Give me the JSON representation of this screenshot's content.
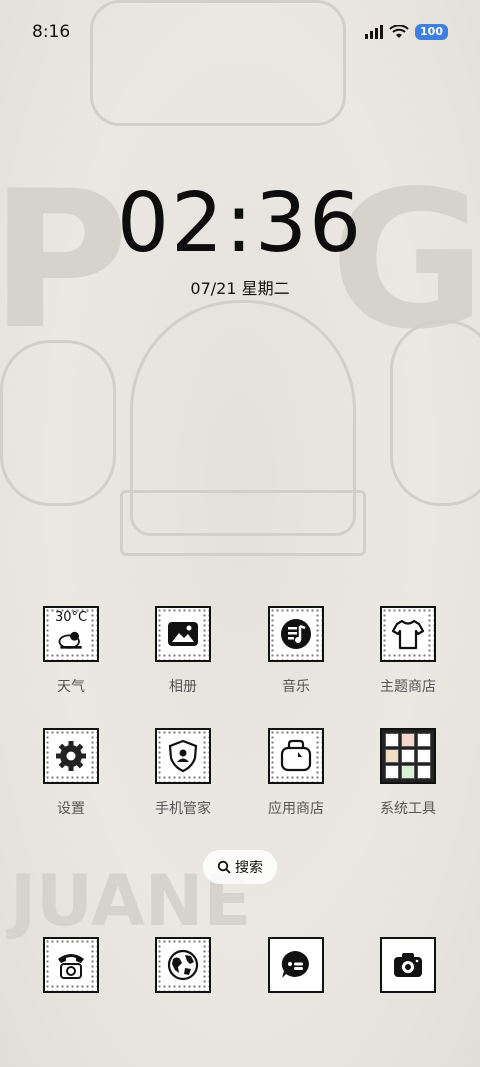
{
  "status_bar": {
    "time": "8:16",
    "battery": "100"
  },
  "lock": {
    "clock": "02:36",
    "date": "07/21 星期二"
  },
  "weather_widget": {
    "temp": "30°C"
  },
  "apps_row1": [
    {
      "label": "天气",
      "icon": "weather-icon"
    },
    {
      "label": "相册",
      "icon": "gallery-icon"
    },
    {
      "label": "音乐",
      "icon": "music-icon"
    },
    {
      "label": "主题商店",
      "icon": "theme-store-icon"
    }
  ],
  "apps_row2": [
    {
      "label": "设置",
      "icon": "gear-icon"
    },
    {
      "label": "手机管家",
      "icon": "security-shield-icon"
    },
    {
      "label": "应用商店",
      "icon": "app-store-bag-icon"
    },
    {
      "label": "系统工具",
      "icon": "system-tools-folder-icon"
    }
  ],
  "search": {
    "label": "搜索"
  },
  "dock": [
    {
      "icon": "phone-icon"
    },
    {
      "icon": "browser-globe-icon"
    },
    {
      "icon": "messages-icon"
    },
    {
      "icon": "camera-icon"
    }
  ],
  "colors": {
    "battery": "#3f7fe0",
    "background": "#e9e6e1"
  }
}
